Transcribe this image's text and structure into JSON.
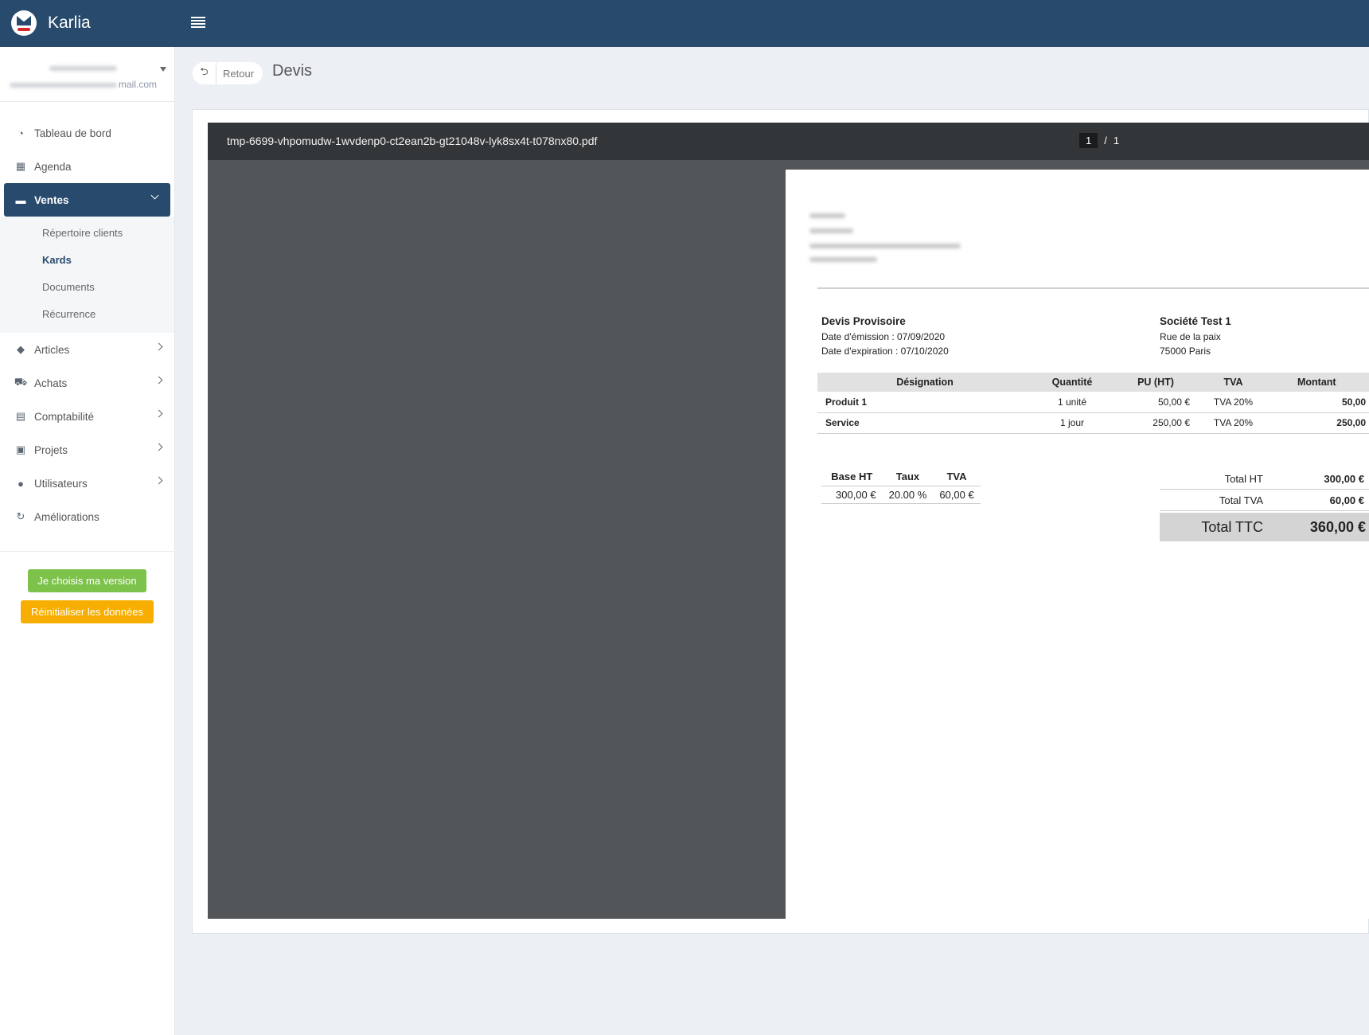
{
  "app": {
    "name": "Karlia"
  },
  "user": {
    "email_suffix": "mail.com"
  },
  "sidebar": {
    "items": [
      {
        "label": "Tableau de bord",
        "icon": "dashboard-icon"
      },
      {
        "label": "Agenda",
        "icon": "calendar-icon"
      },
      {
        "label": "Ventes",
        "icon": "briefcase-icon",
        "active": true,
        "children": [
          "Répertoire clients",
          "Kards",
          "Documents",
          "Récurrence"
        ],
        "current_child": "Kards"
      },
      {
        "label": "Articles",
        "icon": "tags-icon"
      },
      {
        "label": "Achats",
        "icon": "cart-icon"
      },
      {
        "label": "Comptabilité",
        "icon": "calculator-icon"
      },
      {
        "label": "Projets",
        "icon": "project-icon"
      },
      {
        "label": "Utilisateurs",
        "icon": "users-icon"
      },
      {
        "label": "Améliorations",
        "icon": "refresh-icon"
      }
    ],
    "buttons": {
      "version": "Je choisis ma version",
      "reset": "Réinitialiser les données"
    }
  },
  "header": {
    "back_label": "Retour",
    "title": "Devis"
  },
  "viewer": {
    "filename": "tmp-6699-vhpomudw-1wvdenp0-ct2ean2b-gt21048v-lyk8sx4t-t078nx80.pdf",
    "page_current": "1",
    "page_separator": "/",
    "page_total": "1"
  },
  "document": {
    "title": "Devis Provisoire",
    "emission": "Date d'émission : 07/09/2020",
    "expiration": "Date d'expiration : 07/10/2020",
    "client": {
      "name": "Société Test 1",
      "address1": "Rue de la paix",
      "address2": "75000 Paris"
    },
    "columns": [
      "Désignation",
      "Quantité",
      "PU (HT)",
      "TVA",
      "Montant"
    ],
    "rows": [
      {
        "designation": "Produit 1",
        "quantite": "1 unité",
        "pu": "50,00 €",
        "tva": "TVA 20%",
        "montant": "50,00"
      },
      {
        "designation": "Service",
        "quantite": "1 jour",
        "pu": "250,00 €",
        "tva": "TVA 20%",
        "montant": "250,00"
      }
    ],
    "tva_table": {
      "headers": [
        "Base HT",
        "Taux",
        "TVA"
      ],
      "values": [
        "300,00 €",
        "20.00 %",
        "60,00 €"
      ]
    },
    "totals": {
      "ht_label": "Total HT",
      "ht_value": "300,00 €",
      "tva_label": "Total TVA",
      "tva_value": "60,00 €",
      "ttc_label": "Total TTC",
      "ttc_value": "360,00 €"
    }
  }
}
